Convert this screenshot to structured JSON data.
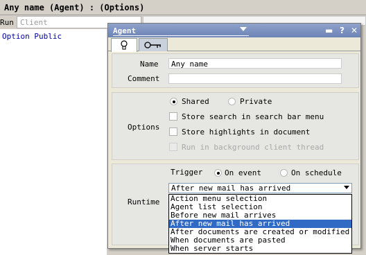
{
  "window": {
    "title": "Any name (Agent) : (Options)"
  },
  "run_bar": {
    "run_label": "Run",
    "client_label": "Client"
  },
  "code": {
    "line": "Option Public"
  },
  "properties": {
    "title": "Agent",
    "controls": {
      "minimize": "▬",
      "help": "?",
      "close": "✕"
    },
    "tabs": [
      {
        "name": "basics",
        "icon": "lightbulb-icon"
      },
      {
        "name": "security",
        "icon": "key-icon"
      }
    ],
    "name_label": "Name",
    "name_value": "Any name",
    "comment_label": "Comment",
    "comment_value": "",
    "options_label": "Options",
    "shared_label": "Shared",
    "private_label": "Private",
    "store_search_label": "Store search in search bar menu",
    "store_highlights_label": "Store highlights in document",
    "run_background_label": "Run in background client thread",
    "runtime_label": "Runtime",
    "trigger_label": "Trigger",
    "on_event_label": "On event",
    "on_schedule_label": "On schedule",
    "trigger_selected": "After new mail has arrived",
    "trigger_options": [
      "Action menu selection",
      "Agent list selection",
      "Before new mail arrives",
      "After new mail has arrived",
      "After documents are created or modified",
      "When documents are pasted",
      "When server starts"
    ]
  },
  "colors": {
    "title_gradient": "#7a92c2",
    "selection": "#316ac5",
    "code_text": "#0000a0"
  }
}
